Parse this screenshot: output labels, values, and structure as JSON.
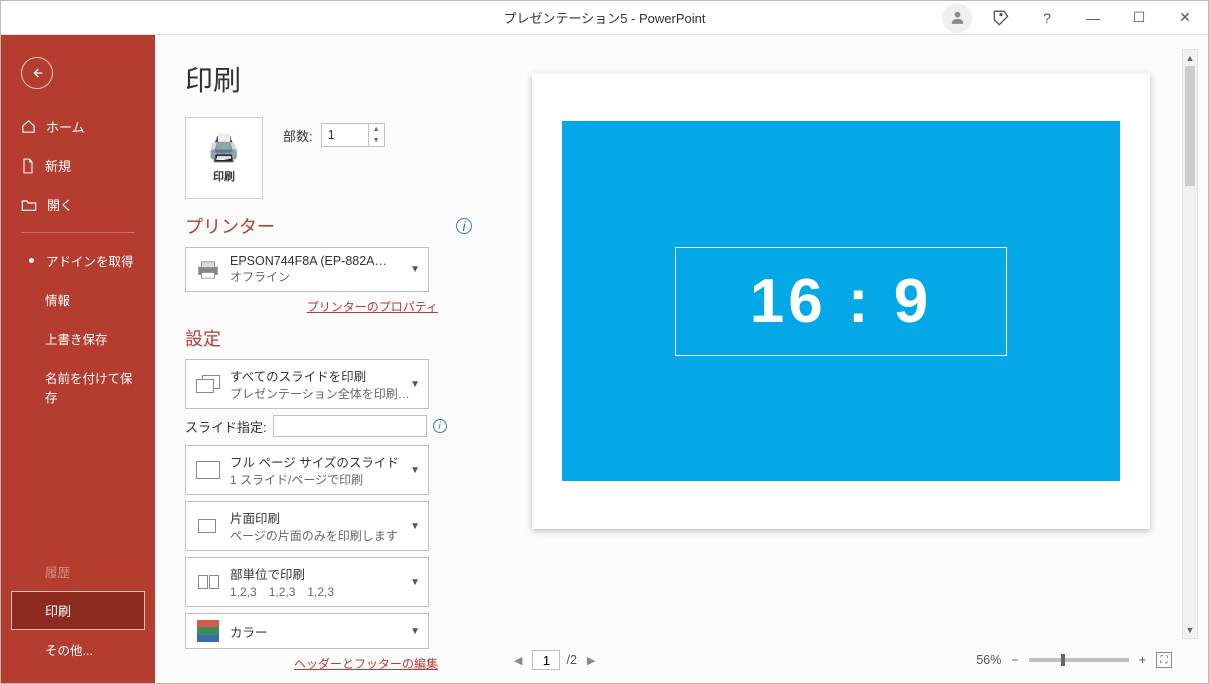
{
  "titlebar": {
    "title": "プレゼンテーション5 - PowerPoint"
  },
  "window_buttons": {
    "help": "?",
    "minimize": "—",
    "maximize": "☐",
    "close": "✕"
  },
  "sidebar": {
    "home": "ホーム",
    "newitem": "新規",
    "open": "開く",
    "getaddins": "アドインを取得",
    "info": "情報",
    "save": "上書き保存",
    "saveas": "名前を付けて保存",
    "history": "履歴",
    "print": "印刷",
    "more": "その他..."
  },
  "print": {
    "heading": "印刷",
    "big_button": "印刷",
    "copies_label": "部数:",
    "copies_value": "1"
  },
  "printer": {
    "section": "プリンター",
    "name": "EPSON744F8A (EP-882A…",
    "status": "オフライン",
    "properties_link": "プリンターのプロパティ"
  },
  "settings": {
    "section": "設定",
    "range": {
      "line1": "すべてのスライドを印刷",
      "line2": "プレゼンテーション全体を印刷し…"
    },
    "slides_label": "スライド指定:",
    "slides_value": "",
    "layout": {
      "line1": "フル ページ サイズのスライド",
      "line2": "1 スライド/ページで印刷"
    },
    "duplex": {
      "line1": "片面印刷",
      "line2": "ページの片面のみを印刷します"
    },
    "collate": {
      "line1": "部単位で印刷",
      "line2": "1,2,3　1,2,3　1,2,3"
    },
    "color": {
      "line1": "カラー"
    },
    "header_footer_link": "ヘッダーとフッターの編集"
  },
  "preview": {
    "slide_text": "16 : 9",
    "page_current": "1",
    "page_total": "/2",
    "zoom": "56%"
  }
}
